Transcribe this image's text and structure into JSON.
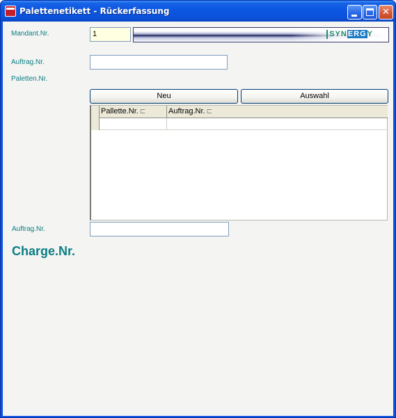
{
  "window": {
    "title": "Palettenetikett - Rückerfassung",
    "icon": "app-icon",
    "controls": {
      "minimize": "minimize-icon",
      "maximize": "maximize-icon",
      "close": "close-icon",
      "close_glyph": "✕"
    }
  },
  "form": {
    "mandant_label": "Mandant.Nr.",
    "mandant_value": "1",
    "auftrag_label": "Auftrag.Nr.",
    "auftrag_value": "",
    "paletten_label": "Paletten.Nr.",
    "auftrag2_label": "Auftrag.Nr.",
    "auftrag2_value": "",
    "charge_label": "Charge.Nr."
  },
  "logo": {
    "text_pre": "SYN",
    "text_hl": "ERG",
    "text_post": "Y"
  },
  "buttons": {
    "neu": "Neu",
    "auswahl": "Auswahl"
  },
  "grid": {
    "columns": [
      {
        "label": "Pallette.Nr."
      },
      {
        "label": "Auftrag.Nr."
      }
    ],
    "rows": [
      [
        "",
        ""
      ]
    ]
  },
  "colors": {
    "label_teal": "#0b7e84",
    "titlebar_blue": "#0a54e0",
    "client_bg": "#f4f4f2",
    "input_highlight": "#ffffe1"
  }
}
